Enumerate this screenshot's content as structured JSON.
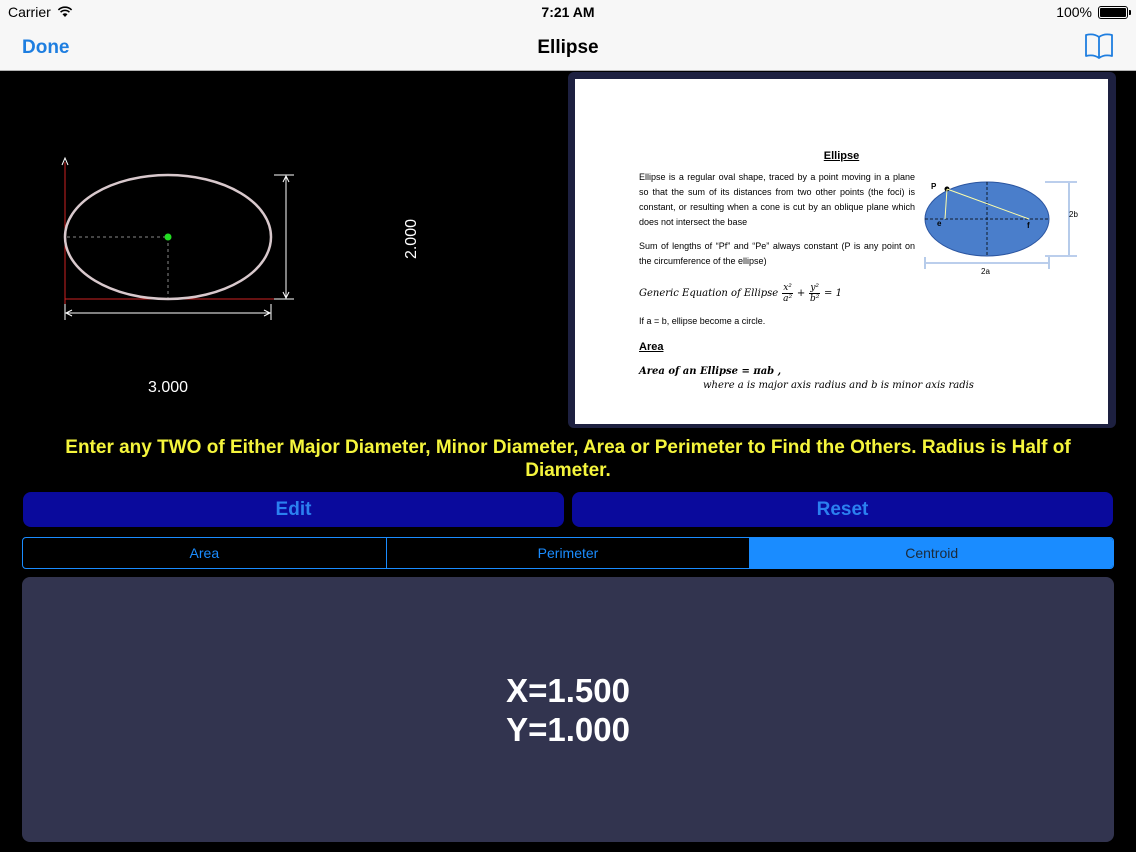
{
  "status_bar": {
    "carrier": "Carrier",
    "time": "7:21 AM",
    "battery": "100%"
  },
  "nav": {
    "back_label": "Done",
    "title": "Ellipse",
    "right_icon": "book-icon"
  },
  "drawing": {
    "width_value": "3.000",
    "height_value": "2.000"
  },
  "reference": {
    "title": "Ellipse",
    "paragraph1": "Ellipse is a regular oval shape, traced by a point moving in a plane so that the sum of its distances from two other points (the foci) is constant, or resulting when a cone is cut by an oblique plane which does not intersect the base",
    "paragraph2": "Sum of lengths of “Pf” and “Pe” always constant (P is any point on the circumference of the ellipse)",
    "equation_label": "Generic Equation of Ellipse",
    "equation_x_num": "x²",
    "equation_x_den": "a²",
    "equation_plus": "+",
    "equation_y_num": "y²",
    "equation_y_den": "b²",
    "equation_rhs": "= 1",
    "circle_note": "If a = b, ellipse become a circle.",
    "area_heading": "Area",
    "area_formula": "Area of an Ellipse = πab ,",
    "area_note": "where a is major axis radius and b is minor axis radis",
    "diagram_labels": {
      "p": "P",
      "e": "e",
      "f": "f",
      "b": "2b",
      "a": "2a"
    }
  },
  "instruction": "Enter any TWO of Either Major Diameter, Minor Diameter, Area or Perimeter to Find the Others. Radius is Half of Diameter.",
  "buttons": {
    "edit": "Edit",
    "reset": "Reset"
  },
  "tabs": [
    {
      "label": "Area",
      "active": false
    },
    {
      "label": "Perimeter",
      "active": false
    },
    {
      "label": "Centroid",
      "active": true
    }
  ],
  "result": {
    "line1": "X=1.500",
    "line2": "Y=1.000"
  },
  "colors": {
    "accent": "#1a8cff",
    "instruction": "#f5f53c",
    "button_bg": "#0a0a9c",
    "panel_bg": "#32344f"
  }
}
